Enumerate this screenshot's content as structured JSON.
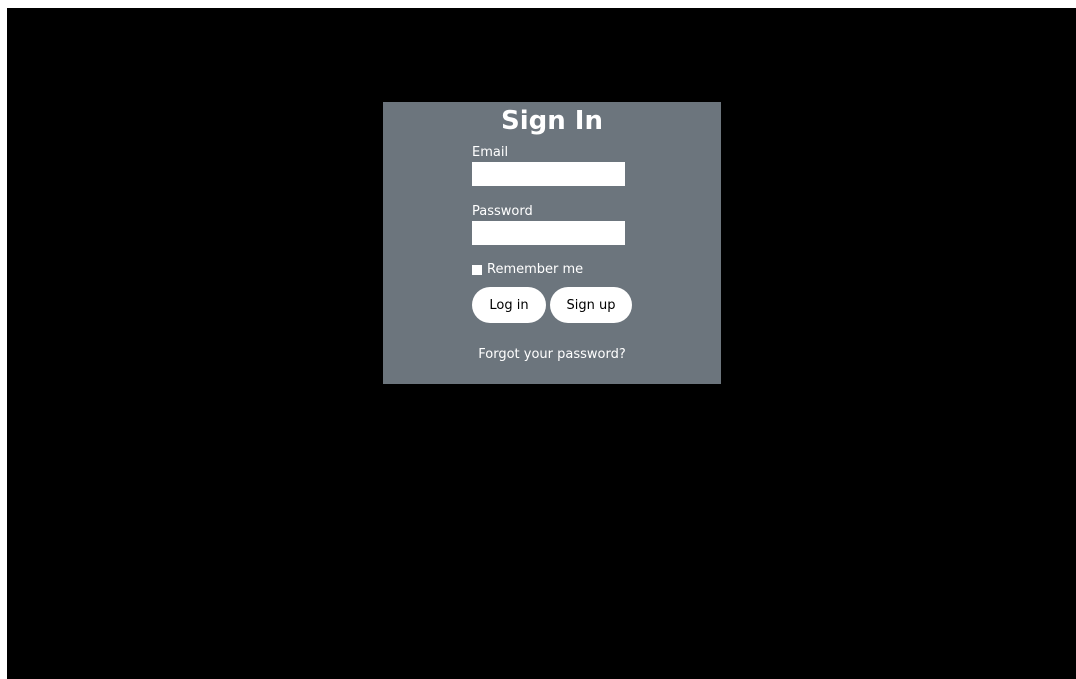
{
  "colors": {
    "page_background": "#000000",
    "card_background": "#6c757d",
    "text": "#ffffff",
    "input_background": "#ffffff",
    "button_background": "#ffffff",
    "button_text": "#000000"
  },
  "signin": {
    "title": "Sign In",
    "email_label": "Email",
    "email_value": "",
    "password_label": "Password",
    "password_value": "",
    "remember_label": "Remember me",
    "remember_checked": false,
    "login_label": "Log in",
    "signup_label": "Sign up",
    "forgot_label": "Forgot your password?"
  }
}
